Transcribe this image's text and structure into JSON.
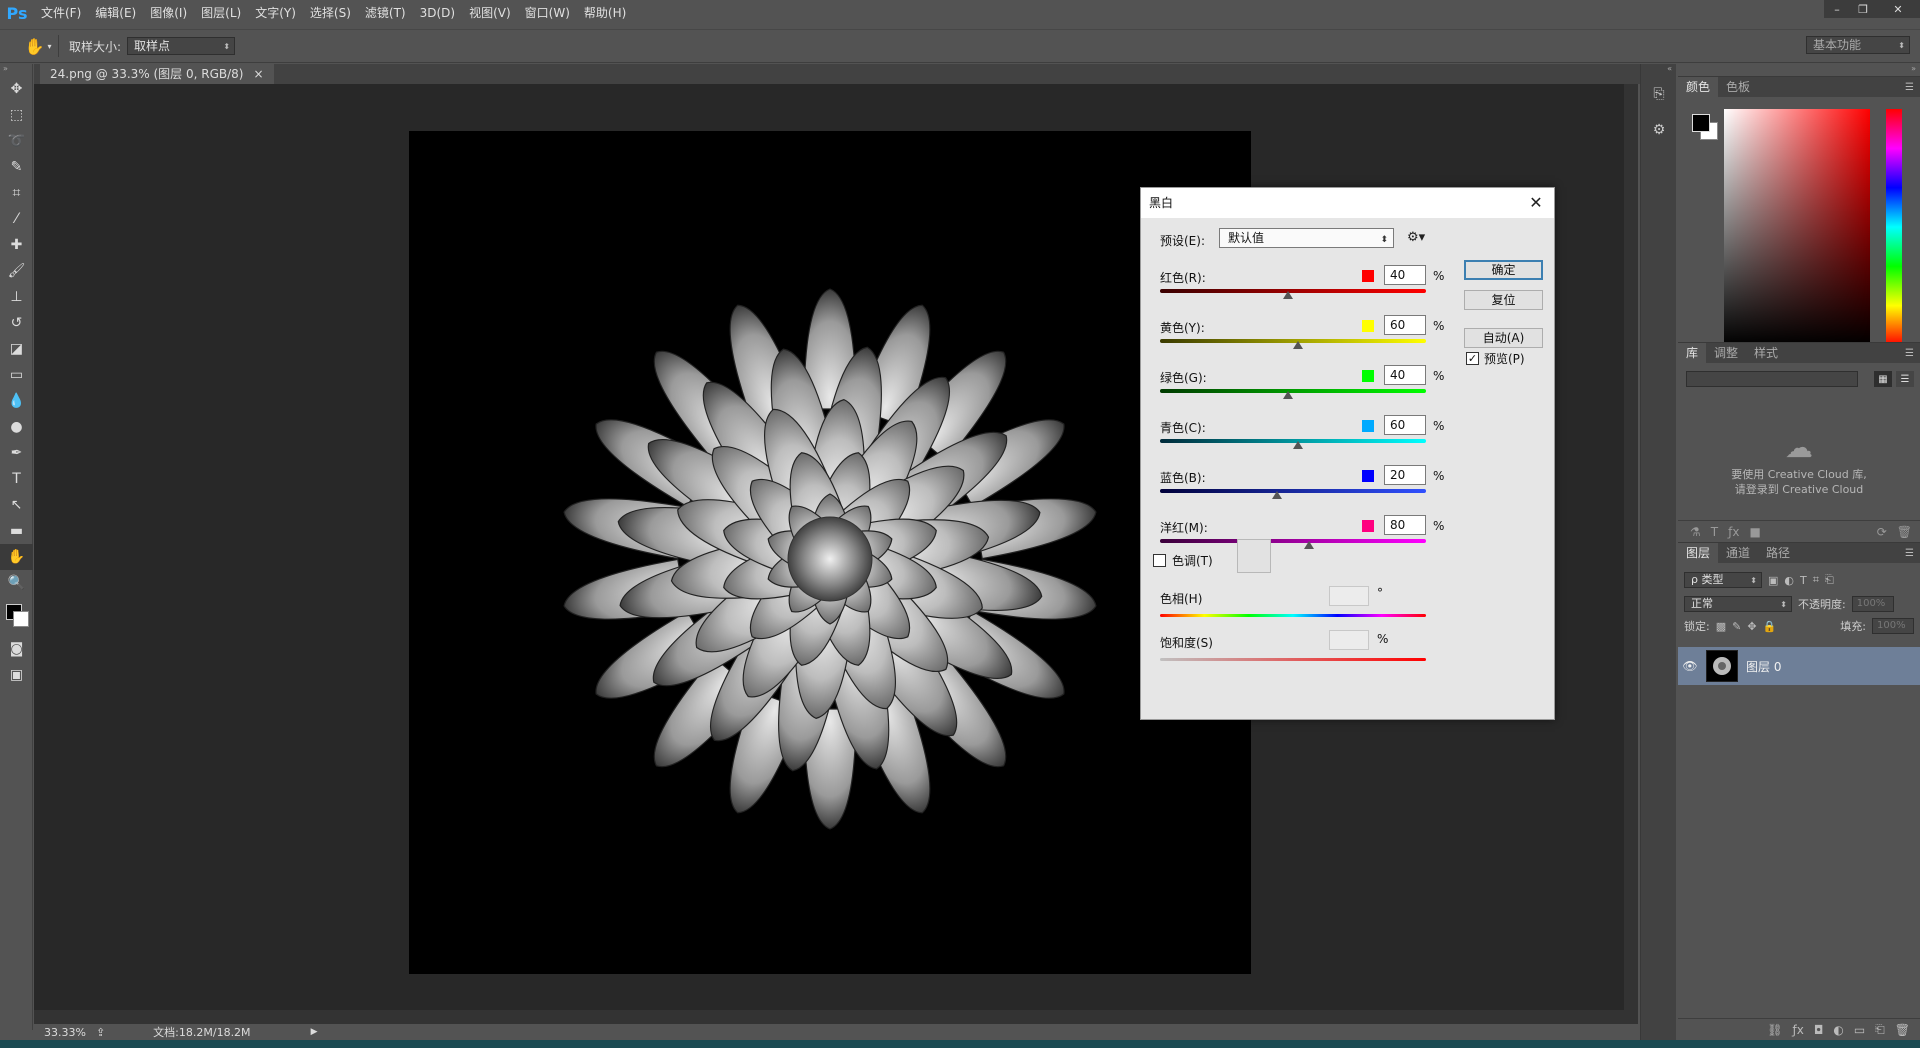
{
  "app": {
    "logo": "Ps",
    "menu": [
      "文件(F)",
      "编辑(E)",
      "图像(I)",
      "图层(L)",
      "文字(Y)",
      "选择(S)",
      "滤镜(T)",
      "3D(D)",
      "视图(V)",
      "窗口(W)",
      "帮助(H)"
    ],
    "window_controls": {
      "minimize": "–",
      "restore": "❐",
      "close": "✕"
    }
  },
  "options_bar": {
    "tool_icon": "hand-icon",
    "sample_size_label": "取样大小:",
    "sample_size_value": "取样点",
    "workspace": "基本功能"
  },
  "document": {
    "tab_title": "24.png @ 33.3% (图层 0, RGB/8)",
    "tab_close": "×"
  },
  "status": {
    "zoom": "33.33%",
    "doc_info": "文档:18.2M/18.2M"
  },
  "color_panel": {
    "tabs": [
      "颜色",
      "色板"
    ],
    "fg_color": "#000000",
    "bg_color": "#ffffff"
  },
  "library_panel": {
    "tabs": [
      "库",
      "调整",
      "样式"
    ],
    "message_line1": "要使用 Creative Cloud 库,",
    "message_line2": "请登录到 Creative Cloud"
  },
  "layers_panel": {
    "tabs": [
      "图层",
      "通道",
      "路径"
    ],
    "filter_type": "ρ 类型",
    "blend_mode": "正常",
    "opacity_label": "不透明度:",
    "opacity_value": "100%",
    "lock_label": "锁定:",
    "fill_label": "填充:",
    "fill_value": "100%",
    "layer_name": "图层 0"
  },
  "bw_dialog": {
    "title": "黑白",
    "preset_label": "预设(E):",
    "preset_value": "默认值",
    "buttons": {
      "ok": "确定",
      "reset": "复位",
      "auto": "自动(A)"
    },
    "preview_label": "预览(P)",
    "preview_checked": true,
    "channels": [
      {
        "label": "红色(R):",
        "value": "40",
        "percent": 40,
        "swatch": "#ff0000",
        "track_from": "#3a0000",
        "track_to": "#ff0000"
      },
      {
        "label": "黄色(Y):",
        "value": "60",
        "percent": 60,
        "swatch": "#ffff00",
        "track_from": "#3a3a00",
        "track_to": "#ffff00"
      },
      {
        "label": "绿色(G):",
        "value": "40",
        "percent": 40,
        "swatch": "#00ff00",
        "track_from": "#003a00",
        "track_to": "#00ff00"
      },
      {
        "label": "青色(C):",
        "value": "60",
        "percent": 60,
        "swatch": "#00aaff",
        "track_from": "#002a3a",
        "track_to": "#00ffff"
      },
      {
        "label": "蓝色(B):",
        "value": "20",
        "percent": 20,
        "swatch": "#0000ff",
        "track_from": "#00003a",
        "track_to": "#3050ff"
      },
      {
        "label": "洋红(M):",
        "value": "80",
        "percent": 80,
        "swatch": "#ff0080",
        "track_from": "#3a003a",
        "track_to": "#ff00ff"
      }
    ],
    "percent_sign": "%",
    "tint_label": "色调(T)",
    "tint_checked": false,
    "hue_label": "色相(H)",
    "hue_unit": "°",
    "saturation_label": "饱和度(S)",
    "saturation_unit": "%"
  }
}
